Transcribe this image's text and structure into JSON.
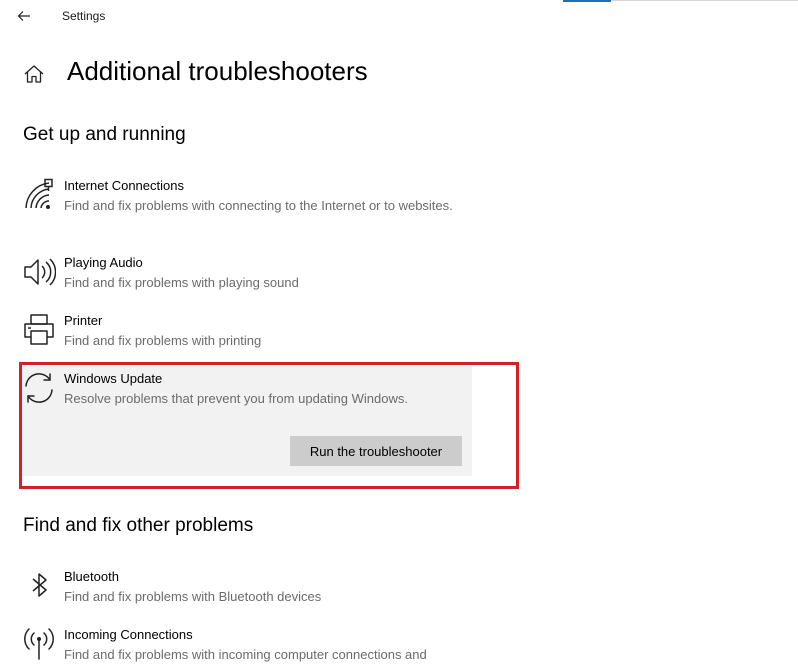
{
  "window": {
    "app_title": "Settings"
  },
  "page": {
    "title": "Additional troubleshooters"
  },
  "sections": {
    "get_up_and_running": {
      "heading": "Get up and running",
      "items": [
        {
          "title": "Internet Connections",
          "description": "Find and fix problems with connecting to the Internet or to websites.",
          "icon": "network-icon"
        },
        {
          "title": "Playing Audio",
          "description": "Find and fix problems with playing sound",
          "icon": "speaker-icon"
        },
        {
          "title": "Printer",
          "description": "Find and fix problems with printing",
          "icon": "printer-icon"
        },
        {
          "title": "Windows Update",
          "description": "Resolve problems that prevent you from updating Windows.",
          "icon": "refresh-icon",
          "button_label": "Run the troubleshooter",
          "selected": true
        }
      ]
    },
    "find_and_fix_other": {
      "heading": "Find and fix other problems",
      "items": [
        {
          "title": "Bluetooth",
          "description": "Find and fix problems with Bluetooth devices",
          "icon": "bluetooth-icon"
        },
        {
          "title": "Incoming Connections",
          "description": "Find and fix problems with incoming computer connections and",
          "icon": "antenna-icon"
        }
      ]
    }
  },
  "colors": {
    "highlight": "#d42027",
    "accent": "#1f6fb5",
    "panel_bg": "#f2f2f2",
    "button_bg": "#cccccc",
    "description_text": "#6b6b6b"
  }
}
